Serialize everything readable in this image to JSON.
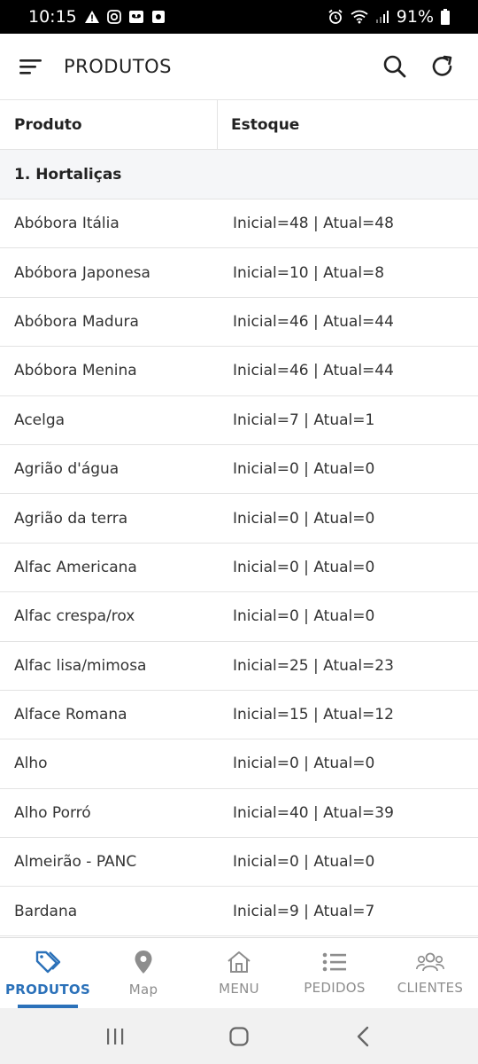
{
  "status_bar": {
    "time": "10:15",
    "battery": "91%"
  },
  "app_bar": {
    "title": "PRODUTOS"
  },
  "table": {
    "headers": {
      "product": "Produto",
      "stock": "Estoque"
    },
    "group": "1. Hortaliças",
    "rows": [
      {
        "product": "Abóbora Itália",
        "stock": "Inicial=48 | Atual=48"
      },
      {
        "product": "Abóbora Japonesa",
        "stock": "Inicial=10 | Atual=8"
      },
      {
        "product": "Abóbora Madura",
        "stock": "Inicial=46 | Atual=44"
      },
      {
        "product": "Abóbora Menina",
        "stock": "Inicial=46 | Atual=44"
      },
      {
        "product": "Acelga",
        "stock": "Inicial=7 | Atual=1"
      },
      {
        "product": "Agrião d'água",
        "stock": "Inicial=0 | Atual=0"
      },
      {
        "product": "Agrião da terra",
        "stock": "Inicial=0 | Atual=0"
      },
      {
        "product": "Alfac Americana",
        "stock": "Inicial=0 | Atual=0"
      },
      {
        "product": "Alfac crespa/rox",
        "stock": "Inicial=0 | Atual=0"
      },
      {
        "product": "Alfac lisa/mimosa",
        "stock": "Inicial=25 | Atual=23"
      },
      {
        "product": "Alface Romana",
        "stock": "Inicial=15 | Atual=12"
      },
      {
        "product": "Alho",
        "stock": "Inicial=0 | Atual=0"
      },
      {
        "product": "Alho Porró",
        "stock": "Inicial=40 | Atual=39"
      },
      {
        "product": "Almeirão - PANC",
        "stock": "Inicial=0 | Atual=0"
      },
      {
        "product": "Bardana",
        "stock": "Inicial=9 | Atual=7"
      }
    ]
  },
  "bottom_nav": [
    {
      "label": "PRODUTOS",
      "icon": "tags-icon",
      "active": true
    },
    {
      "label": "Map",
      "icon": "map-pin-icon",
      "active": false
    },
    {
      "label": "MENU",
      "icon": "home-icon",
      "active": false
    },
    {
      "label": "PEDIDOS",
      "icon": "list-icon",
      "active": false
    },
    {
      "label": "CLIENTES",
      "icon": "users-icon",
      "active": false
    }
  ],
  "colors": {
    "accent": "#2b71b9",
    "inactive": "#8d8d8d",
    "group_bg": "#f5f6f8"
  }
}
